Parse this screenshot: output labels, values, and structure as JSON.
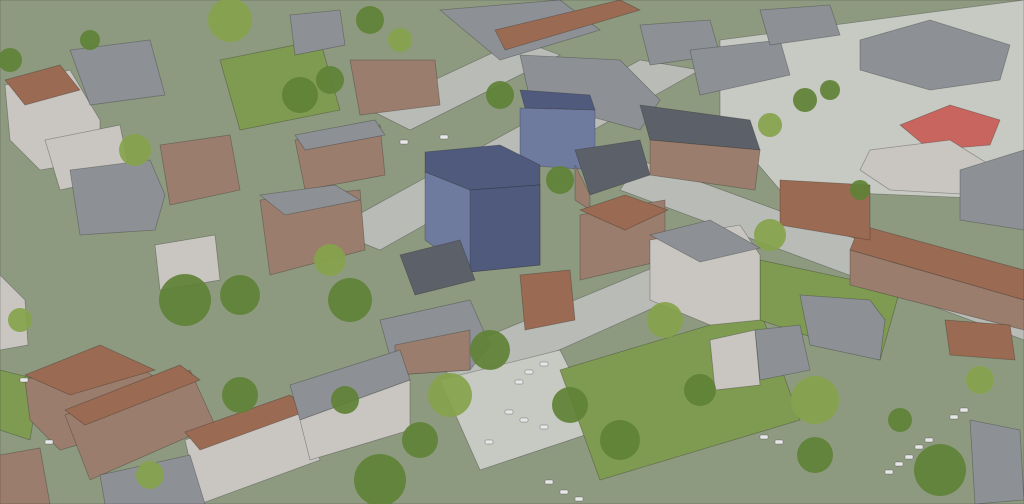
{
  "scene": {
    "subject": "aerial-city-block",
    "colors": {
      "ground": "#8e9a80",
      "street": "#b9bcb6",
      "lot": "#c7c9c3",
      "grass": "#7f9b52",
      "tree": "#5f8236",
      "tree_light": "#86a34c",
      "roof_grey": "#8d9196",
      "roof_dark": "#5c6068",
      "roof_rust": "#9a6a52",
      "roof_red": "#c8655f",
      "wall_brick": "#9a7d6c",
      "wall_pale": "#c9c6c2",
      "new_building": "#6f7b9e",
      "new_building_dark": "#4f5a7c",
      "car": "#e6e6e6"
    }
  }
}
